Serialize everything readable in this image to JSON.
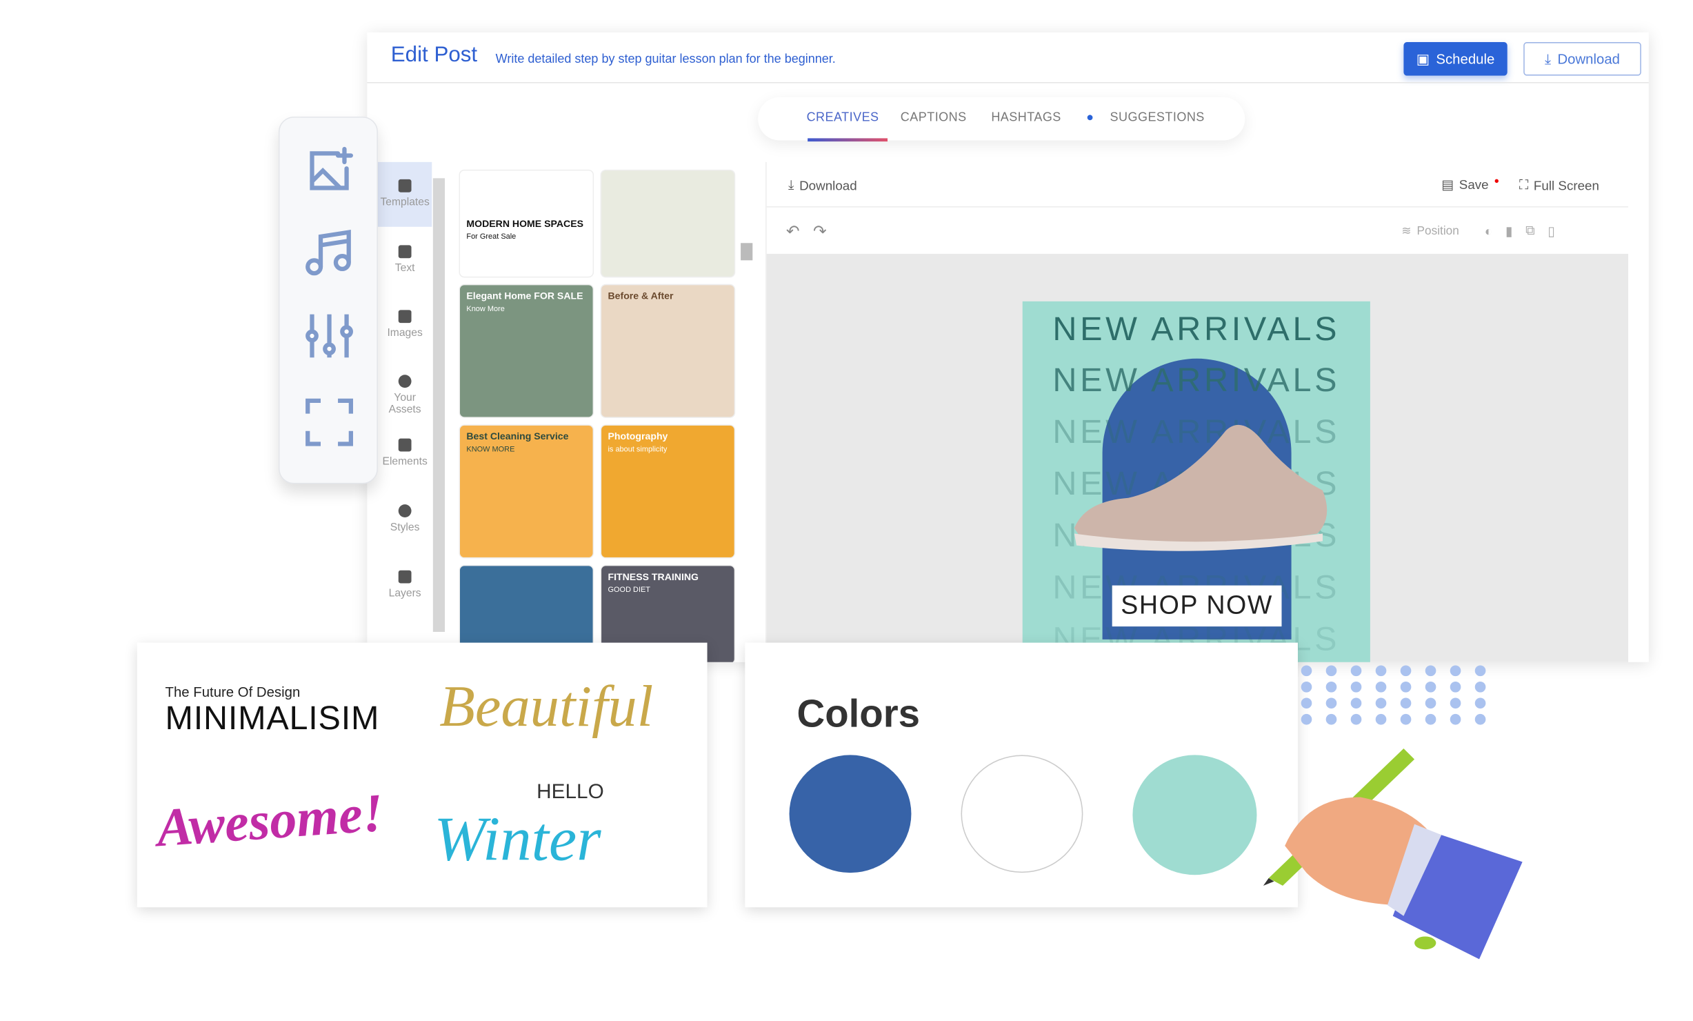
{
  "header": {
    "title": "Edit Post",
    "subtitle": "Write detailed step by step guitar lesson plan for the beginner.",
    "schedule": "Schedule",
    "download": "Download"
  },
  "tabs": [
    {
      "label": "CREATIVES",
      "active": true
    },
    {
      "label": "CAPTIONS"
    },
    {
      "label": "HASHTAGS"
    },
    {
      "label": "SUGGESTIONS"
    }
  ],
  "side_nav": [
    {
      "label": "Templates",
      "active": true
    },
    {
      "label": "Text"
    },
    {
      "label": "Images"
    },
    {
      "label": "Your Assets"
    },
    {
      "label": "Elements"
    },
    {
      "label": "Styles"
    },
    {
      "label": "Layers"
    }
  ],
  "templates": [
    {
      "title": "MODERN HOME SPACES",
      "sub": "For Great Sale",
      "bg": "#ffffff",
      "fg": "#111"
    },
    {
      "title": "",
      "sub": "",
      "bg": "#e9ebe0",
      "fg": "#333"
    },
    {
      "title": "Elegant Home FOR SALE",
      "sub": "Know More",
      "bg": "#7c9580",
      "fg": "#fff"
    },
    {
      "title": "Before & After",
      "sub": "",
      "bg": "#ead8c4",
      "fg": "#6b4a2e"
    },
    {
      "title": "Best Cleaning Service",
      "sub": "KNOW MORE",
      "bg": "#f6b24d",
      "fg": "#2d4a3e"
    },
    {
      "title": "Photography",
      "sub": "is about simplicity",
      "bg": "#f0a830",
      "fg": "#fff"
    },
    {
      "title": "",
      "sub": "",
      "bg": "#3b6f9a",
      "fg": "#fff"
    },
    {
      "title": "FITNESS TRAINING",
      "sub": "GOOD DIET",
      "bg": "#5a5a66",
      "fg": "#fff"
    }
  ],
  "editor": {
    "download": "Download",
    "save": "Save",
    "fullscreen": "Full Screen",
    "position": "Position"
  },
  "artboard": {
    "lines": [
      "NEW ARRIVALS",
      "NEW ARRIVALS",
      "NEW ARRIVALS",
      "NEW ARRIVALS",
      "NEW ARRIVALS",
      "NEW ARRIVALS",
      "NEW ARRIVALS"
    ],
    "cta": "SHOP NOW"
  },
  "fonts_card": {
    "small": "The Future Of Design",
    "big": "MINIMALISIM",
    "script1": "Beautiful",
    "script2": "Awesome!",
    "hello": "HELLO",
    "script3": "Winter"
  },
  "colors_card": {
    "title": "Colors",
    "swatches": [
      "#3763a8",
      "#ffffff",
      "#9fdcd1"
    ]
  }
}
